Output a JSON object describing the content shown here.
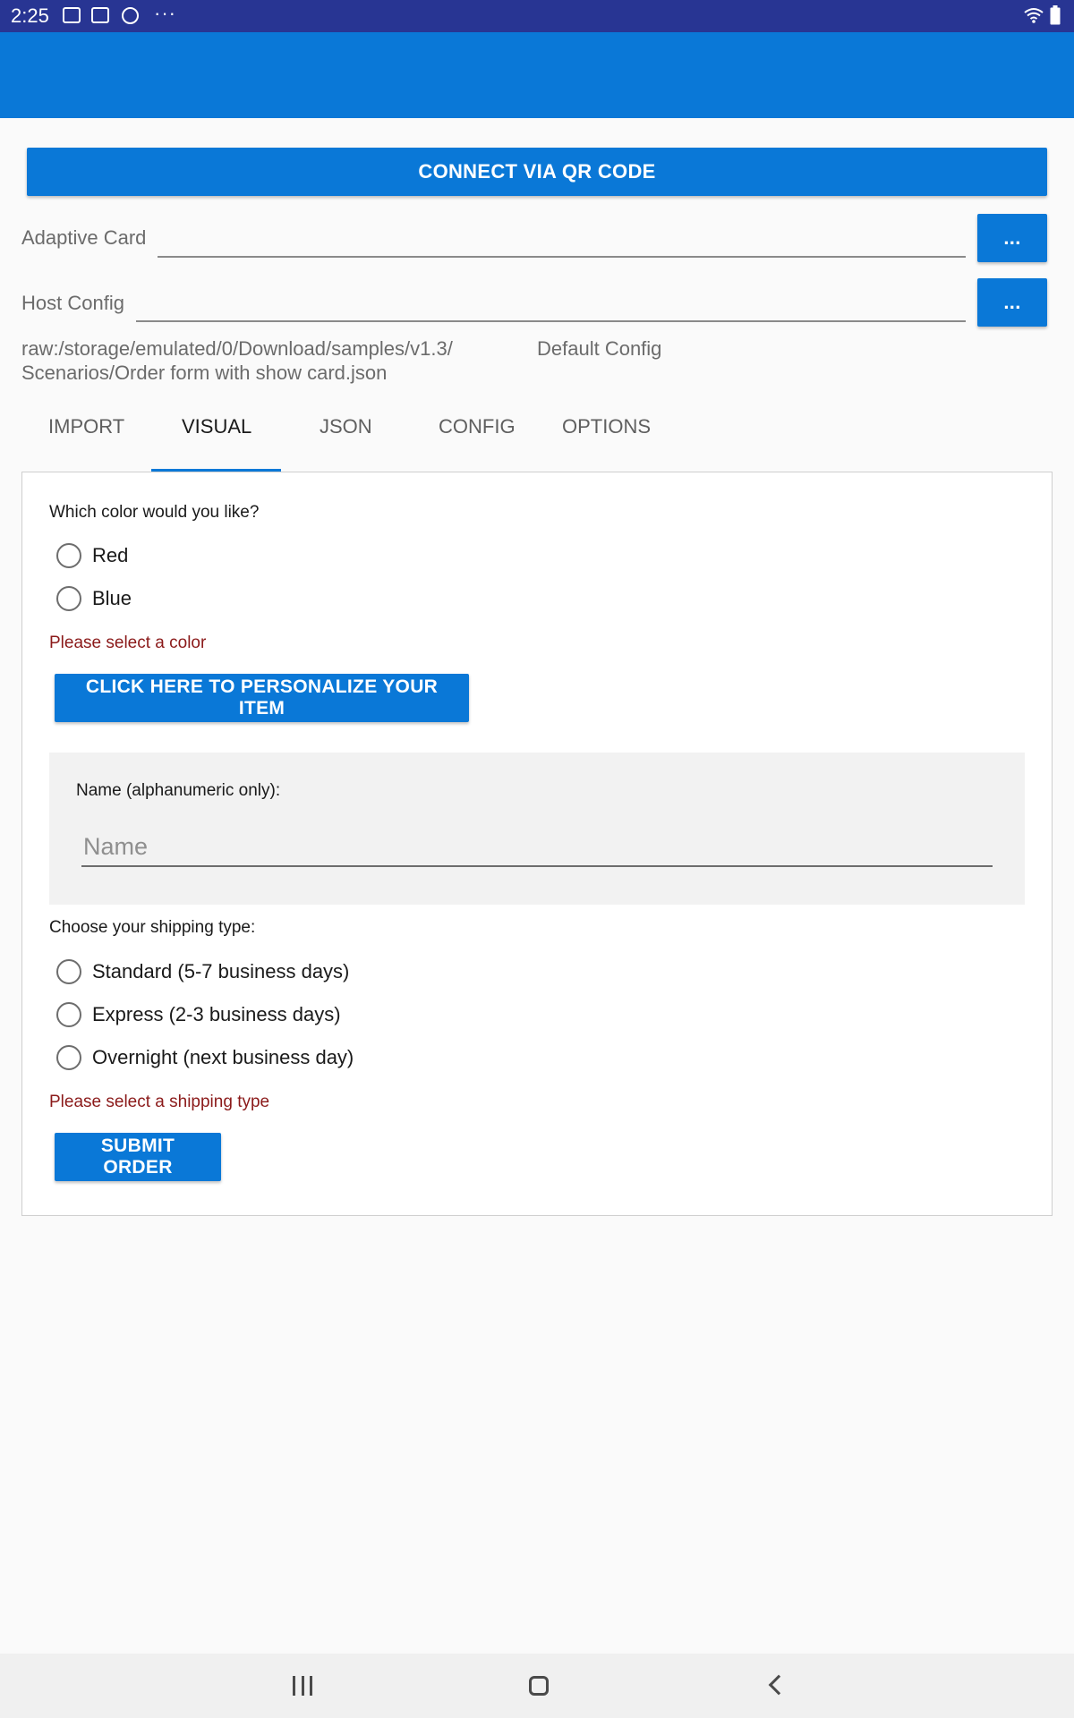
{
  "status_bar": {
    "time": "2:25",
    "overflow": "···",
    "icons": [
      "image-icon",
      "mail-icon",
      "globe-icon",
      "wifi-icon",
      "battery-icon"
    ]
  },
  "toolbar": {
    "connect_label": "CONNECT VIA QR CODE"
  },
  "fields": {
    "adaptive_card_label": "Adaptive Card",
    "host_config_label": "Host Config",
    "browse_label": "..."
  },
  "paths": {
    "card_path_line1": "raw:/storage/emulated/0/Download/samples/v1.3/",
    "card_path_line2": "Scenarios/Order form with show card.json",
    "host_config_value": "Default Config"
  },
  "tabs": [
    {
      "label": "IMPORT"
    },
    {
      "label": "VISUAL"
    },
    {
      "label": "JSON"
    },
    {
      "label": "CONFIG"
    },
    {
      "label": "OPTIONS"
    }
  ],
  "selected_tab": "VISUAL",
  "card": {
    "color_question": "Which color would you like?",
    "color_options": [
      {
        "label": "Red"
      },
      {
        "label": "Blue"
      }
    ],
    "color_error": "Please select a color",
    "personalize_button": "CLICK HERE TO PERSONALIZE YOUR ITEM",
    "name_label": "Name (alphanumeric only):",
    "name_placeholder": "Name",
    "name_value": "",
    "shipping_question": "Choose your shipping type:",
    "shipping_options": [
      {
        "label": "Standard (5-7 business days)"
      },
      {
        "label": "Express (2-3 business days)"
      },
      {
        "label": "Overnight (next business day)"
      }
    ],
    "shipping_error": "Please select a shipping type",
    "submit_button": "SUBMIT ORDER"
  },
  "colors": {
    "status_bar": "#283593",
    "accent": "#0a78d7",
    "error": "#8b1a1a"
  }
}
